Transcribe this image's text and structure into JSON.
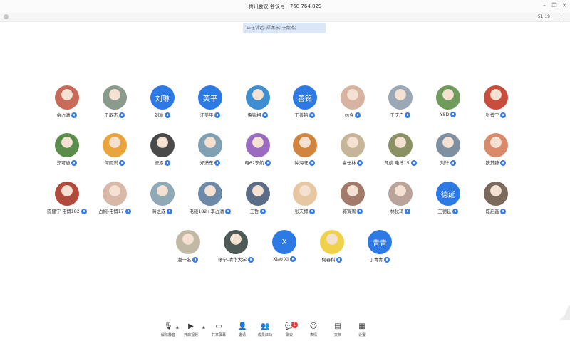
{
  "window": {
    "title": "腾讯会议 会议号：768 764 829",
    "timer": "51:19",
    "speaking": "正在讲话: 郑潇东; 于歆杰;"
  },
  "participants": [
    {
      "name": "余占清",
      "avatar": "photo",
      "color": "#c86b5a"
    },
    {
      "name": "于歆杰",
      "avatar": "photo",
      "color": "#8a9b8c"
    },
    {
      "name": "刘琳",
      "avatar": "text",
      "initials": "刘琳"
    },
    {
      "name": "汪美平",
      "avatar": "text",
      "initials": "芙平"
    },
    {
      "name": "鲁宗相",
      "avatar": "photo",
      "color": "#3e8fd1"
    },
    {
      "name": "王善铭",
      "avatar": "text",
      "initials": "善铭"
    },
    {
      "name": "林今",
      "avatar": "photo",
      "color": "#d9b3a2"
    },
    {
      "name": "于庆广",
      "avatar": "photo",
      "color": "#9aa7b5"
    },
    {
      "name": "YSD",
      "avatar": "photo",
      "color": "#6f9c5b"
    },
    {
      "name": "张博宁",
      "avatar": "photo",
      "color": "#c94d3d"
    },
    {
      "name": "郑可迪",
      "avatar": "photo",
      "color": "#5b8d4a"
    },
    {
      "name": "何雨淇",
      "avatar": "photo",
      "color": "#e9a43c"
    },
    {
      "name": "檀添",
      "avatar": "photo",
      "color": "#4a4a4a"
    },
    {
      "name": "郑潇东",
      "avatar": "photo",
      "color": "#7fa1b3"
    },
    {
      "name": "电62李航",
      "avatar": "photo",
      "color": "#9b6bc1"
    },
    {
      "name": "钟海旺",
      "avatar": "photo",
      "color": "#d1843c"
    },
    {
      "name": "高仕林",
      "avatar": "photo",
      "color": "#c7b59a"
    },
    {
      "name": "凡航 电博15",
      "avatar": "photo",
      "color": "#8c9164"
    },
    {
      "name": "刘洋",
      "avatar": "photo",
      "color": "#7d8fa0"
    },
    {
      "name": "魏其臻",
      "avatar": "photo",
      "color": "#d98a6a"
    },
    {
      "name": "陈健宁 电博182",
      "avatar": "photo",
      "color": "#b24a3c"
    },
    {
      "name": "占婉-电博17",
      "avatar": "photo",
      "color": "#d8b8a6"
    },
    {
      "name": "蒋之成",
      "avatar": "photo",
      "color": "#8fa9b7"
    },
    {
      "name": "电硕182+李占清",
      "avatar": "photo",
      "color": "#6c8aa8"
    },
    {
      "name": "王哲",
      "avatar": "photo",
      "color": "#5a6c86"
    },
    {
      "name": "张天博",
      "avatar": "photo",
      "color": "#e6c7a2"
    },
    {
      "name": "郭寅离",
      "avatar": "photo",
      "color": "#a37b6a"
    },
    {
      "name": "林秋琦",
      "avatar": "photo",
      "color": "#b9a39a"
    },
    {
      "name": "王德延",
      "avatar": "text",
      "initials": "德延"
    },
    {
      "name": "陈启鑫",
      "avatar": "photo",
      "color": "#7b6a5c"
    },
    {
      "name": "赵一名",
      "avatar": "photo",
      "color": "#c2b8a6"
    },
    {
      "name": "张宁-清华大学",
      "avatar": "photo",
      "color": "#4e5a55"
    },
    {
      "name": "Xiao Xi",
      "avatar": "text",
      "initials": "X"
    },
    {
      "name": "何春科",
      "avatar": "photo",
      "color": "#f0d24a"
    },
    {
      "name": "丁青青",
      "avatar": "text",
      "initials": "青青"
    }
  ],
  "toolbar": {
    "items": [
      {
        "label": "解除静音",
        "icon": "mic-muted-icon"
      },
      {
        "label": "开启视频",
        "icon": "video-off-icon"
      },
      {
        "label": "共享屏幕",
        "icon": "share-screen-icon"
      },
      {
        "label": "邀请",
        "icon": "invite-icon"
      },
      {
        "label": "成员(35)",
        "icon": "members-icon"
      },
      {
        "label": "聊天",
        "icon": "chat-icon",
        "badge": "1"
      },
      {
        "label": "表情",
        "icon": "emoji-icon"
      },
      {
        "label": "文档",
        "icon": "document-icon"
      },
      {
        "label": "设置",
        "icon": "settings-icon"
      }
    ]
  },
  "colors": {
    "accent": "#2d7ae5",
    "badge": "#e23b3b",
    "banner": "#dbe7f7"
  }
}
